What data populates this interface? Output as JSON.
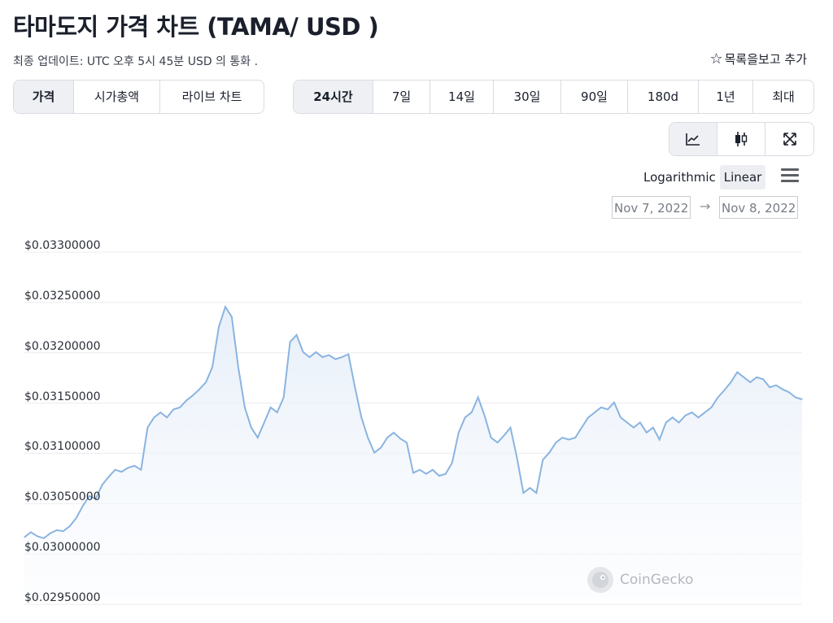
{
  "header": {
    "title": "타마도지 가격 차트 (TAMA/ USD )",
    "updated": "최종 업데이트: UTC 오후 5시 45분 USD 의 통화 .",
    "add_to_watchlist": "목록을보고 추가"
  },
  "chart_type_tabs": [
    {
      "label": "가격",
      "active": true
    },
    {
      "label": "시가총액",
      "active": false
    },
    {
      "label": "라이브 차트",
      "active": false
    }
  ],
  "range_tabs": [
    {
      "label": "24시간",
      "active": true
    },
    {
      "label": "7일",
      "active": false
    },
    {
      "label": "14일",
      "active": false
    },
    {
      "label": "30일",
      "active": false
    },
    {
      "label": "90일",
      "active": false
    },
    {
      "label": "180d",
      "active": false
    },
    {
      "label": "1년",
      "active": false
    },
    {
      "label": "최대",
      "active": false
    }
  ],
  "view_tools": [
    {
      "icon": "line-chart-icon",
      "active": true
    },
    {
      "icon": "candlestick-icon",
      "active": false
    },
    {
      "icon": "fullscreen-icon",
      "active": false
    }
  ],
  "scale": {
    "logarithmic": "Logarithmic",
    "linear": "Linear",
    "active": "linear"
  },
  "date_range": {
    "from": "Nov 7, 2022",
    "to": "Nov 8, 2022",
    "arrow": "→"
  },
  "watermark": "CoinGecko",
  "colors": {
    "line": "#8ab4e0",
    "fill_top": "#e4edf8",
    "grid": "#ececef"
  },
  "chart_data": {
    "type": "area",
    "xlabel": "",
    "ylabel": "",
    "ylim": [
      0.02945,
      0.03335
    ],
    "y_ticks": [
      "$0.03300000",
      "$0.03250000",
      "$0.03200000",
      "$0.03150000",
      "$0.03100000",
      "$0.03050000",
      "$0.03000000",
      "$0.02950000"
    ],
    "y_tick_values": [
      0.033,
      0.0325,
      0.032,
      0.0315,
      0.031,
      0.0305,
      0.03,
      0.0295
    ],
    "values": [
      0.03011,
      0.03016,
      0.03012,
      0.0301,
      0.03015,
      0.03018,
      0.03017,
      0.03022,
      0.0303,
      0.03042,
      0.03052,
      0.03049,
      0.03063,
      0.03071,
      0.03078,
      0.03076,
      0.0308,
      0.03082,
      0.03078,
      0.0312,
      0.0313,
      0.03135,
      0.0313,
      0.03138,
      0.0314,
      0.03147,
      0.03152,
      0.03158,
      0.03165,
      0.0318,
      0.0322,
      0.0324,
      0.0323,
      0.0318,
      0.0314,
      0.0312,
      0.0311,
      0.03125,
      0.0314,
      0.03135,
      0.0315,
      0.03205,
      0.03212,
      0.03195,
      0.0319,
      0.03195,
      0.0319,
      0.03192,
      0.03188,
      0.0319,
      0.03193,
      0.0316,
      0.0313,
      0.0311,
      0.03095,
      0.031,
      0.0311,
      0.03115,
      0.03109,
      0.03105,
      0.03075,
      0.03078,
      0.03074,
      0.03078,
      0.03072,
      0.03074,
      0.03085,
      0.03115,
      0.0313,
      0.03135,
      0.0315,
      0.03132,
      0.0311,
      0.03105,
      0.03112,
      0.0312,
      0.0309,
      0.03055,
      0.0306,
      0.03055,
      0.03088,
      0.03095,
      0.03105,
      0.0311,
      0.03108,
      0.0311,
      0.0312,
      0.0313,
      0.03135,
      0.0314,
      0.03138,
      0.03145,
      0.0313,
      0.03125,
      0.0312,
      0.03125,
      0.03115,
      0.0312,
      0.03108,
      0.03125,
      0.0313,
      0.03125,
      0.03132,
      0.03135,
      0.0313,
      0.03135,
      0.0314,
      0.0315,
      0.03157,
      0.03165,
      0.03175,
      0.0317,
      0.03165,
      0.0317,
      0.03168,
      0.0316,
      0.03162,
      0.03158,
      0.03155,
      0.0315,
      0.03148
    ]
  }
}
